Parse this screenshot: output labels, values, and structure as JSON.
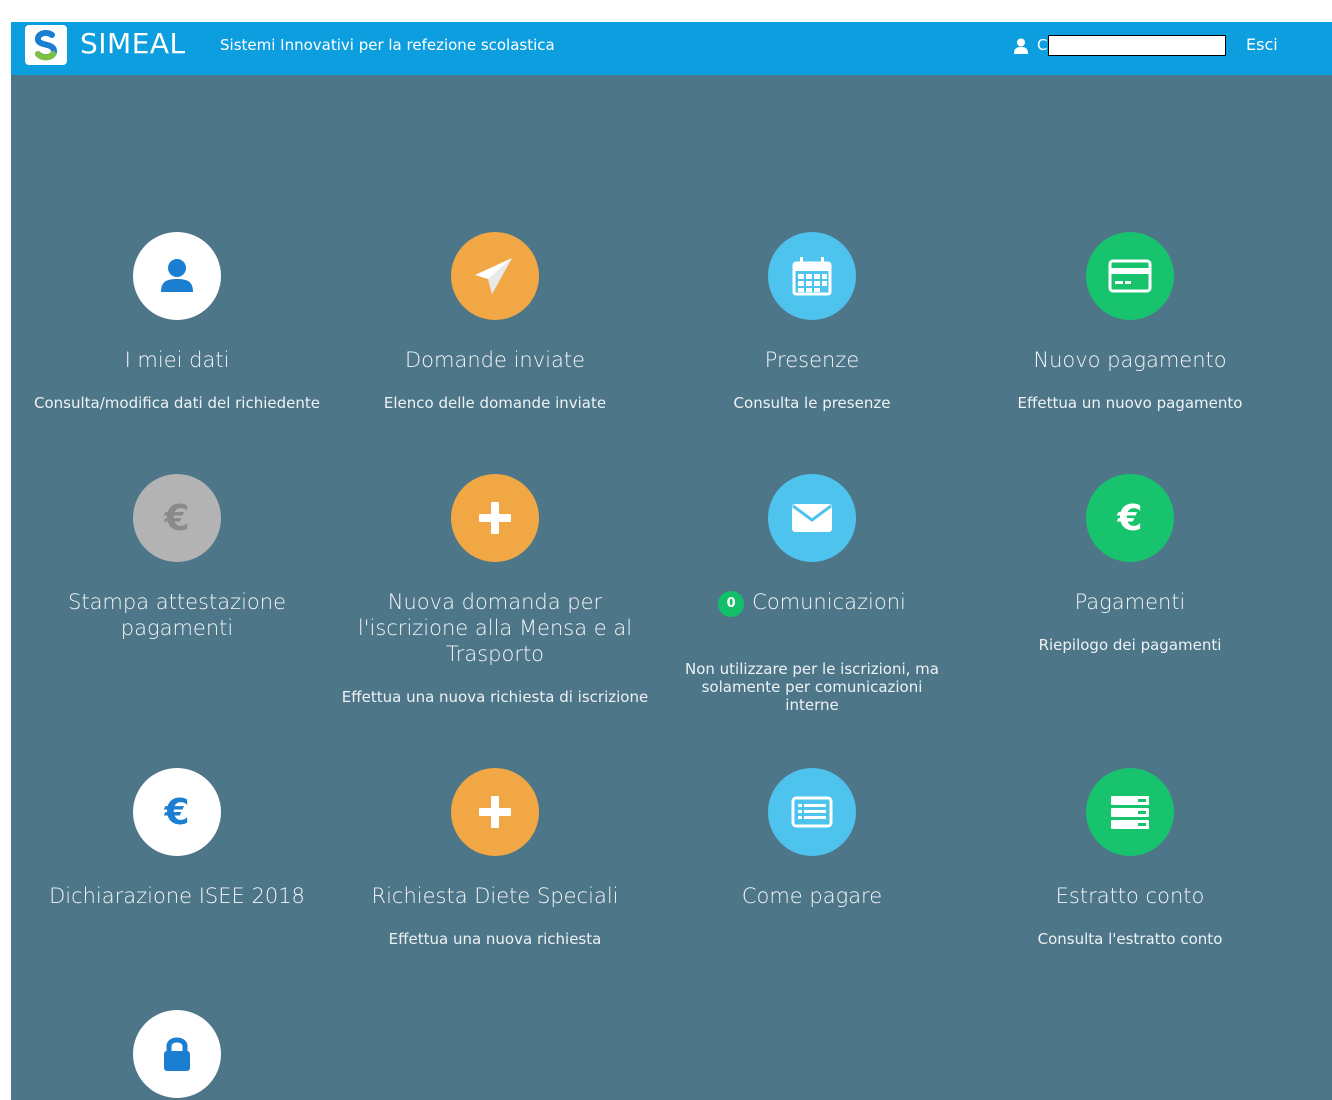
{
  "header": {
    "brand": "SIMEAL",
    "tagline": "Sistemi Innovativi per la refezione scolastica",
    "user_initial": "C",
    "logout_label": "Esci"
  },
  "colors": {
    "header": "#0d9ee0",
    "background": "#4e7689",
    "orange": "#f0a744",
    "light_blue": "#4dc3ee",
    "green": "#17c36d",
    "grey": "#b3b3b3",
    "blue_icon": "#1a7fd0"
  },
  "tiles": [
    {
      "title": "I miei dati",
      "description": "Consulta/modifica dati del richiedente",
      "icon": "user-icon"
    },
    {
      "title": "Domande inviate",
      "description": "Elenco delle domande inviate",
      "icon": "paper-plane-icon"
    },
    {
      "title": "Presenze",
      "description": "Consulta le presenze",
      "icon": "calendar-icon"
    },
    {
      "title": "Nuovo pagamento",
      "description": "Effettua un nuovo pagamento",
      "icon": "credit-card-icon"
    },
    {
      "title": "Stampa attestazione pagamenti",
      "description": "",
      "icon": "euro-icon"
    },
    {
      "title": "Nuova domanda per l'iscrizione alla Mensa e al Trasporto",
      "description": "Effettua una nuova richiesta di iscrizione",
      "icon": "plus-icon"
    },
    {
      "title": "Comunicazioni",
      "badge": "0",
      "description": "Non utilizzare per le iscrizioni, ma solamente per comunicazioni interne",
      "icon": "envelope-icon"
    },
    {
      "title": "Pagamenti",
      "description": "Riepilogo dei pagamenti",
      "icon": "euro-icon"
    },
    {
      "title": "Dichiarazione ISEE 2018",
      "description": "",
      "icon": "euro-icon"
    },
    {
      "title": "Richiesta Diete Speciali",
      "description": "Effettua una nuova richiesta",
      "icon": "plus-icon"
    },
    {
      "title": "Come pagare",
      "description": "",
      "icon": "list-card-icon"
    },
    {
      "title": "Estratto conto",
      "description": "Consulta l'estratto conto",
      "icon": "server-icon"
    },
    {
      "title": "",
      "description": "",
      "icon": "lock-icon"
    }
  ]
}
